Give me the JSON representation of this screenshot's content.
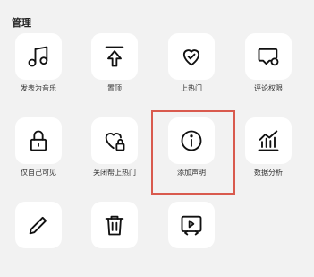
{
  "section": {
    "title": "管理"
  },
  "items": [
    {
      "label": "发表为音乐",
      "icon": "music-note-icon"
    },
    {
      "label": "置顶",
      "icon": "pin-top-icon"
    },
    {
      "label": "上热门",
      "icon": "heart-boost-icon"
    },
    {
      "label": "评论权限",
      "icon": "comment-settings-icon"
    },
    {
      "label": "仅自己可见",
      "icon": "lock-icon"
    },
    {
      "label": "关闭帮上热门",
      "icon": "heart-lock-icon"
    },
    {
      "label": "添加声明",
      "icon": "info-icon"
    },
    {
      "label": "数据分析",
      "icon": "analytics-chart-icon"
    },
    {
      "label": "",
      "icon": "pencil-icon"
    },
    {
      "label": "",
      "icon": "trash-icon"
    },
    {
      "label": "",
      "icon": "video-code-icon"
    }
  ],
  "highlight": {
    "target": "添加声明",
    "color": "#d95a4e"
  }
}
